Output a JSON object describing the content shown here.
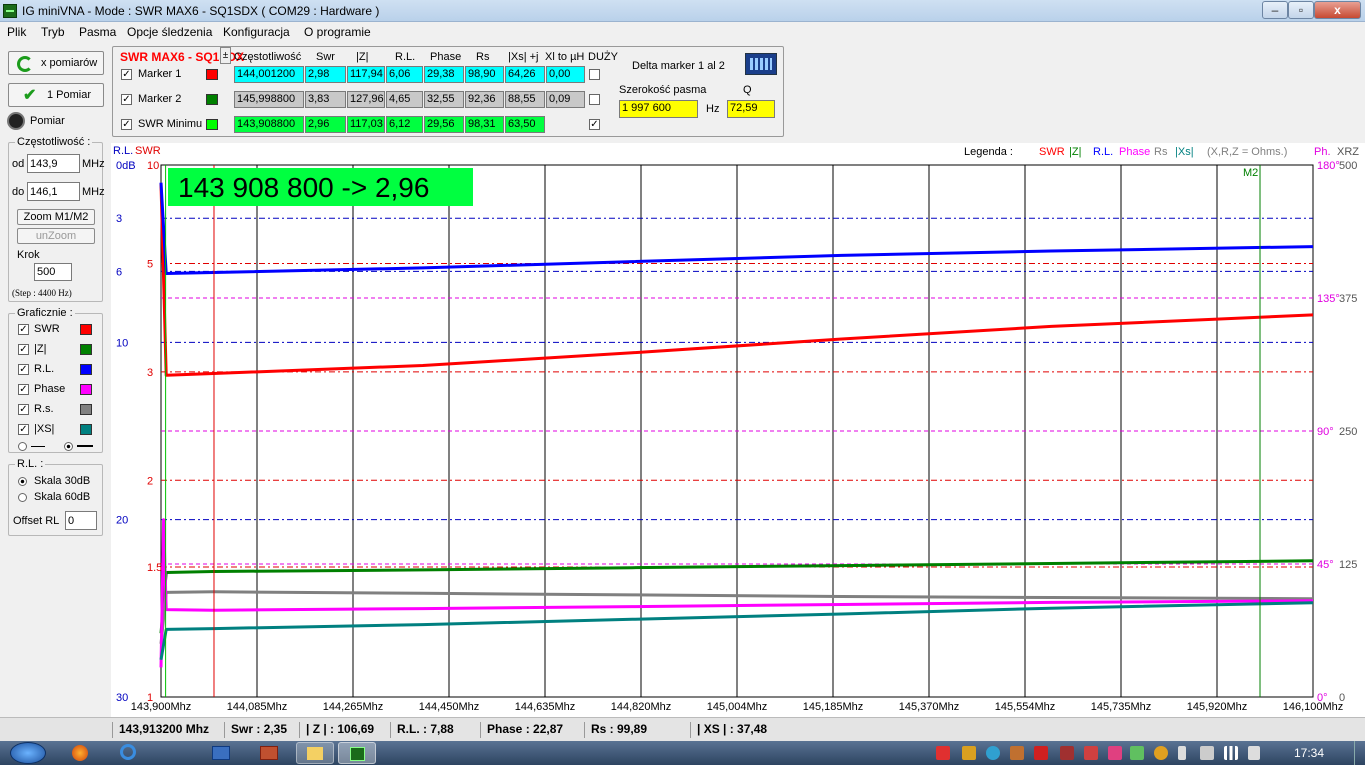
{
  "window": {
    "title": "IG miniVNA - Mode : SWR MAX6 - SQ1SDX ( COM29 :  Hardware )",
    "min": "–",
    "max": "▫",
    "close": "x"
  },
  "menu": [
    "Plik",
    "Tryb",
    "Pasma",
    "Opcje śledzenia",
    "Konfiguracja",
    "O programie"
  ],
  "left": {
    "btn_sweeps": "x pomiarów",
    "btn_single": "1 Pomiar",
    "radio_measure": "Pomiar",
    "freq_group": "Częstotliwość :",
    "from_label": "od",
    "from_value": "143,9",
    "to_label": "do",
    "to_value": "146,1",
    "mhz": "MHz",
    "zoom": "Zoom M1/M2",
    "unzoom": "unZoom",
    "step_label": "Krok",
    "step_value": "500",
    "step_info": "(Step : 4400 Hz)",
    "graphics_group": "Graficznie :",
    "graphs": [
      {
        "label": "SWR",
        "color": "#ff0000"
      },
      {
        "label": "|Z|",
        "color": "#008000"
      },
      {
        "label": "R.L.",
        "color": "#0000ff"
      },
      {
        "label": "Phase",
        "color": "#ff00ff"
      },
      {
        "label": "R.s.",
        "color": "#808080"
      },
      {
        "label": "|XS|",
        "color": "#008080"
      }
    ],
    "rl_group": "R.L. :",
    "rl_30": "Skala 30dB",
    "rl_60": "Skala 60dB",
    "offset_label": "Offset RL",
    "offset_value": "0"
  },
  "markers": {
    "title": "SWR MAX6 - SQ1SDX",
    "headers": [
      "Częstotliwość",
      "Swr",
      "|Z|",
      "R.L.",
      "Phase",
      "Rs",
      "|Xs| +j",
      "Xl to µH",
      "DUŻY"
    ],
    "rows": [
      {
        "label": "Marker 1",
        "color": "#ff0000",
        "pm": "±",
        "values": [
          "144,001200",
          "2,98",
          "117,94",
          "6,06",
          "29,38",
          "98,90",
          "64,26",
          "0,00"
        ]
      },
      {
        "label": "Marker 2",
        "color": "#008000",
        "pm": "±",
        "values": [
          "145,998800",
          "3,83",
          "127,96",
          "4,65",
          "32,55",
          "92,36",
          "88,55",
          "0,09"
        ]
      },
      {
        "label": "SWR Minimu",
        "color": "#00ff00",
        "values": [
          "143,908800",
          "2,96",
          "117,03",
          "6,12",
          "29,56",
          "98,31",
          "63,50"
        ]
      }
    ],
    "delta_title": "Delta marker 1 al 2",
    "bw_label": "Szerokość pasma",
    "q_label": "Q",
    "bw_value": "1 997 600",
    "hz": "Hz",
    "q_value": "72,59"
  },
  "chart": {
    "corner_rl": "R.L.",
    "corner_swr": "SWR",
    "legend_title": "Legenda :",
    "legend": [
      {
        "label": "SWR",
        "color": "#ff0000"
      },
      {
        "label": "|Z|",
        "color": "#008000"
      },
      {
        "label": "R.L.",
        "color": "#0000ff"
      },
      {
        "label": "Phase",
        "color": "#ff00ff"
      },
      {
        "label": "Rs",
        "color": "#808080"
      },
      {
        "label": "|Xs|",
        "color": "#008080"
      },
      {
        "label": "(X,R,Z = Ohms.)",
        "color": "#808080"
      }
    ],
    "right_ph": "Ph.",
    "right_xrz": "XRZ",
    "big_label": "143 908 800 -> 2,96",
    "m2_label": "M2",
    "rl_ticks": [
      {
        "v": 0,
        "t": "0dB"
      },
      {
        "v": 3,
        "t": "3"
      },
      {
        "v": 6,
        "t": "6"
      },
      {
        "v": 10,
        "t": "10"
      },
      {
        "v": 20,
        "t": "20"
      },
      {
        "v": 30,
        "t": "30"
      }
    ],
    "swr_ticks": [
      {
        "v": 10,
        "t": "10"
      },
      {
        "v": 5,
        "t": "5"
      },
      {
        "v": 3,
        "t": "3"
      },
      {
        "v": 2,
        "t": "2"
      },
      {
        "v": 1.5,
        "t": "1.5"
      },
      {
        "v": 1,
        "t": "1"
      }
    ],
    "phase_ticks": [
      {
        "v": 180,
        "t": "180°"
      },
      {
        "v": 135,
        "t": "135°"
      },
      {
        "v": 90,
        "t": "90°"
      },
      {
        "v": 45,
        "t": "45°"
      },
      {
        "v": 0,
        "t": "0°"
      }
    ],
    "xrz_ticks": [
      {
        "v": 500,
        "t": "500"
      },
      {
        "v": 375,
        "t": "375"
      },
      {
        "v": 250,
        "t": "250"
      },
      {
        "v": 125,
        "t": "125"
      },
      {
        "v": 0,
        "t": "0"
      }
    ]
  },
  "chart_data": {
    "type": "line",
    "x_labels": [
      "143,900Mhz",
      "144,085Mhz",
      "144,265Mhz",
      "144,450Mhz",
      "144,635Mhz",
      "144,820Mhz",
      "145,004Mhz",
      "145,185Mhz",
      "145,370Mhz",
      "145,554Mhz",
      "145,735Mhz",
      "145,920Mhz",
      "146,100Mhz"
    ],
    "xlim": [
      143.9,
      146.1
    ],
    "markers": {
      "m1": 144.0012,
      "m2": 145.9988,
      "swr_min": 143.9088
    },
    "series": [
      {
        "name": "SWR",
        "axis": "swr",
        "color": "#ff0000",
        "x": [
          143.9,
          143.91,
          144.0,
          144.4,
          144.8,
          145.2,
          145.6,
          146.1
        ],
        "values": [
          8.5,
          2.96,
          2.98,
          3.08,
          3.25,
          3.45,
          3.65,
          3.85
        ]
      },
      {
        "name": "R.L.",
        "axis": "rl",
        "color": "#0000ff",
        "x": [
          143.9,
          143.91,
          144.0,
          144.4,
          144.8,
          145.2,
          145.6,
          146.1
        ],
        "values": [
          1.0,
          6.12,
          6.06,
          5.8,
          5.45,
          5.1,
          4.85,
          4.6
        ]
      },
      {
        "name": "|Z|",
        "axis": "xrz",
        "color": "#008000",
        "x": [
          143.9,
          143.91,
          144.0,
          144.4,
          144.8,
          145.2,
          145.6,
          146.1
        ],
        "values": [
          60,
          117.03,
          117.94,
          119.5,
          121.5,
          123.5,
          125.5,
          128.0
        ]
      },
      {
        "name": "Rs",
        "axis": "xrz",
        "color": "#808080",
        "x": [
          143.9,
          143.91,
          144.0,
          144.4,
          144.8,
          145.2,
          145.6,
          146.1
        ],
        "values": [
          50,
          98.31,
          98.9,
          97.5,
          96.0,
          94.5,
          93.5,
          92.4
        ]
      },
      {
        "name": "Phase",
        "axis": "phase",
        "color": "#ff00ff",
        "x": [
          143.9,
          143.905,
          143.91,
          144.0,
          144.4,
          144.8,
          145.2,
          145.6,
          146.1
        ],
        "values": [
          10,
          60,
          29.56,
          29.38,
          29.9,
          30.6,
          31.3,
          32.0,
          32.55
        ]
      },
      {
        "name": "|Xs|",
        "axis": "xrz",
        "color": "#008080",
        "x": [
          143.9,
          143.91,
          144.0,
          144.4,
          144.8,
          145.2,
          145.6,
          146.1
        ],
        "values": [
          35,
          63.5,
          64.26,
          68,
          73,
          78,
          83.5,
          88.55
        ]
      }
    ]
  },
  "status": {
    "freq": "143,913200 Mhz",
    "swr": "Swr : 2,35",
    "z": "| Z | : 106,69",
    "rl": "R.L. : 7,88",
    "phase": "Phase : 22,87",
    "rs": "Rs : 99,89",
    "xs": "| XS | : 37,48"
  },
  "taskbar": {
    "clock": "17:34"
  }
}
